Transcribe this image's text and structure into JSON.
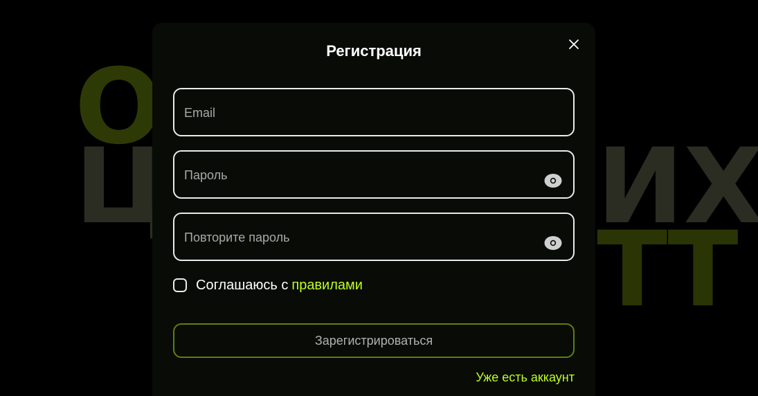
{
  "background": {
    "lines": [
      "О",
      "Ц",
      "ИХ",
      "ТТ"
    ]
  },
  "modal": {
    "title": "Регистрация",
    "close_icon": "close-icon",
    "fields": {
      "email": {
        "placeholder": "Email",
        "value": ""
      },
      "password": {
        "placeholder": "Пароль",
        "value": "",
        "icon": "eye-icon"
      },
      "repeat_password": {
        "placeholder": "Повторите пароль",
        "value": "",
        "icon": "eye-icon"
      }
    },
    "agree": {
      "checked": false,
      "text": "Соглашаюсь с",
      "link": "правилами"
    },
    "submit_label": "Зарегистрироваться",
    "login_link": "Уже есть аккаунт"
  },
  "colors": {
    "background": "#000000",
    "modal": "#090b06",
    "accent": "#bfff1f",
    "button_border": "#5f7f12",
    "field_border": "#ececec"
  }
}
